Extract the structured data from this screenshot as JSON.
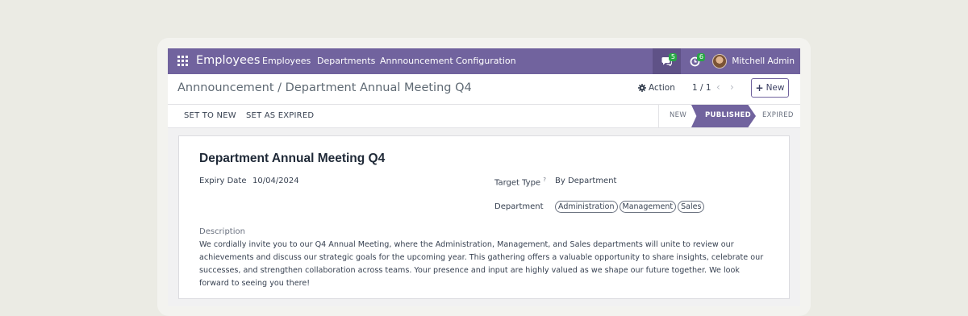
{
  "navbar": {
    "app_name": "Employees",
    "menu": [
      "Employees",
      "Departments",
      "Annnouncement",
      "Configuration"
    ],
    "chat_count": "5",
    "activity_count": "6",
    "user_name": "Mitchell Admin",
    "color": "#71639e"
  },
  "control": {
    "breadcrumb": "Annnouncement / Department Annual Meeting Q4",
    "action_label": "Action",
    "pager": "1 / 1",
    "new_label": "New"
  },
  "statusbar": {
    "buttons": [
      "SET TO NEW",
      "SET AS EXPIRED"
    ],
    "stages": [
      "NEW",
      "PUBLISHED",
      "EXPIRED"
    ],
    "active_stage": "PUBLISHED"
  },
  "form": {
    "title": "Department Annual Meeting Q4",
    "expiry_label": "Expiry Date",
    "expiry_value": "10/04/2024",
    "target_type_label": "Target Type",
    "target_type_help": "?",
    "target_type_value": "By Department",
    "department_label": "Department",
    "departments": [
      "Administration",
      "Management",
      "Sales"
    ],
    "description_label": "Description",
    "description": "We cordially invite you to our Q4 Annual Meeting, where the Administration, Management, and Sales departments will unite to review our achievements and discuss our strategic goals for the upcoming year. This gathering offers a valuable opportunity to share insights, celebrate our successes, and strengthen collaboration across teams. Your presence and input are highly valued as we shape our future together. We look forward to seeing you there!"
  },
  "icons": [
    "apps-grid-icon",
    "chat-icon",
    "activity-clock-icon",
    "gear-icon",
    "chevron-left-icon",
    "chevron-right-icon",
    "plus-icon"
  ]
}
